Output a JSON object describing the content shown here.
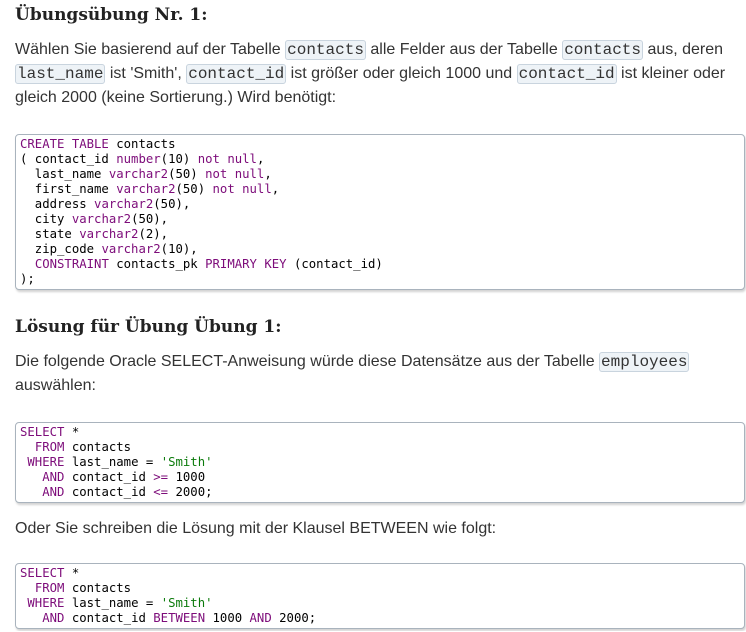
{
  "exercise": {
    "heading": "Übungsübung Nr. 1:",
    "text": {
      "p1": "Wählen Sie basierend auf der Tabelle ",
      "c1": "contacts",
      "p2": " alle Felder aus der Tabelle ",
      "c2": "contacts",
      "p3": " aus, deren ",
      "c3": "last_name",
      "p4": " ist 'Smith', ",
      "c4": "contact_id",
      "p5": " ist größer oder gleich 1000 und ",
      "c5": "contact_id",
      "p6": " ist kleiner oder gleich 2000 (keine Sortierung.) Wird benötigt:"
    }
  },
  "create_table": {
    "l1a": "CREATE TABLE",
    "l1b": " contacts",
    "l2a": "( contact_id ",
    "l2b": "number",
    "l2c": "(10) ",
    "l2d": "not null",
    "l2e": ",",
    "l3a": "  last_name ",
    "l3b": "varchar2",
    "l3c": "(50) ",
    "l3d": "not null",
    "l3e": ",",
    "l4a": "  first_name ",
    "l4b": "varchar2",
    "l4c": "(50) ",
    "l4d": "not null",
    "l4e": ",",
    "l5a": "  address ",
    "l5b": "varchar2",
    "l5c": "(50),",
    "l6a": "  city ",
    "l6b": "varchar2",
    "l6c": "(50),",
    "l7a": "  state ",
    "l7b": "varchar2",
    "l7c": "(2),",
    "l8a": "  zip_code ",
    "l8b": "varchar2",
    "l8c": "(10),",
    "l9a": "  ",
    "l9b": "CONSTRAINT",
    "l9c": " contacts_pk ",
    "l9d": "PRIMARY KEY",
    "l9e": " (contact_id)",
    "l10": ");"
  },
  "solution": {
    "heading": "Lösung für Übung Übung 1:",
    "text": {
      "p1": "Die folgende Oracle SELECT-Anweisung würde diese Datensätze aus der Tabelle ",
      "c1": "employees",
      "p2": " auswählen:"
    }
  },
  "query1": {
    "l1a": "SELECT",
    "l1b": " *",
    "l2a": "  ",
    "l2b": "FROM",
    "l2c": " contacts",
    "l3a": " ",
    "l3b": "WHERE",
    "l3c": " last_name = ",
    "l3d": "'Smith'",
    "l4a": "   ",
    "l4b": "AND",
    "l4c": " contact_id ",
    "l4d": ">=",
    "l4e": " 1000",
    "l5a": "   ",
    "l5b": "AND",
    "l5c": " contact_id ",
    "l5d": "<=",
    "l5e": " 2000;"
  },
  "between_text": "Oder Sie schreiben die Lösung mit der Klausel BETWEEN wie folgt:",
  "query2": {
    "l1a": "SELECT",
    "l1b": " *",
    "l2a": "  ",
    "l2b": "FROM",
    "l2c": " contacts",
    "l3a": " ",
    "l3b": "WHERE",
    "l3c": " last_name = ",
    "l3d": "'Smith'",
    "l4a": "   ",
    "l4b": "AND",
    "l4c": " contact_id ",
    "l4d": "BETWEEN",
    "l4e": " 1000 ",
    "l4f": "AND",
    "l4g": " 2000;"
  }
}
